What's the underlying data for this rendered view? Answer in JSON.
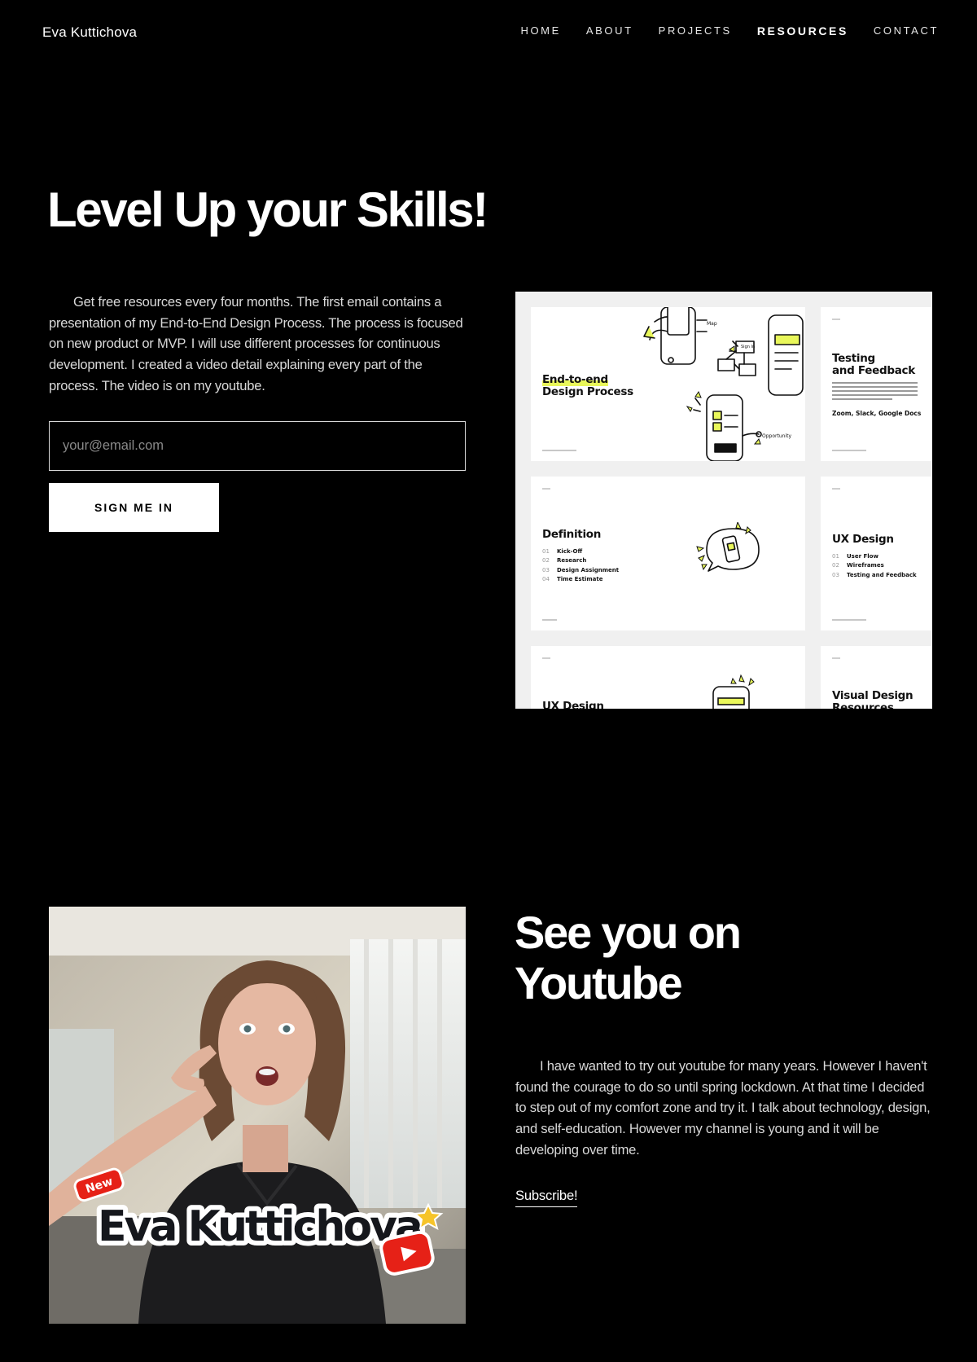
{
  "header": {
    "brand": "Eva Kuttichova",
    "nav": [
      {
        "label": "HOME"
      },
      {
        "label": "ABOUT"
      },
      {
        "label": "PROJECTS"
      },
      {
        "label": "RESOURCES",
        "active": true
      },
      {
        "label": "CONTACT"
      }
    ]
  },
  "hero": {
    "title": "Level Up your Skills!",
    "body": "Get free resources every four months. The first email contains a presentation of my End-to-End Design Process. The process is focused on new product or MVP. I will use different processes for continuous development. I created a video detail explaining every part of the process. The video is on my youtube.",
    "email_placeholder": "your@email.com",
    "email_value": "",
    "signup_label": "SIGN ME IN"
  },
  "slides": {
    "s1_title_a": "End-to-end",
    "s1_title_b": "Design Process",
    "s2_title_a": "Testing",
    "s2_title_b": "and Feedback",
    "s2_tools": "Zoom, Slack, Google Docs",
    "s3_title": "Definition",
    "s3_items": [
      {
        "n": "01",
        "label": "Kick-Off"
      },
      {
        "n": "02",
        "label": "Research"
      },
      {
        "n": "03",
        "label": "Design Assignment"
      },
      {
        "n": "04",
        "label": "Time Estimate"
      }
    ],
    "s4_title": "UX Design",
    "s4_items": [
      {
        "n": "01",
        "label": "User Flow"
      },
      {
        "n": "02",
        "label": "Wireframes"
      },
      {
        "n": "03",
        "label": "Testing and Feedback"
      }
    ],
    "s5_title": "UX Design",
    "s6_title_a": "Visual Design",
    "s6_title_b": "Resources",
    "sketch_labels": {
      "map": "Map",
      "sign_in": "Sign In",
      "opportunity": "Opportunity"
    }
  },
  "youtube": {
    "title_line1": "See you on",
    "title_line2": "Youtube",
    "body": "I have wanted to try out youtube for many years. However I haven't found the courage to do so until spring lockdown. At that time I decided to step out of my comfort zone and try it. I talk about technology, design, and self-education. However my channel is young and it will be developing over time.",
    "subscribe_label": "Subscribe!",
    "thumbnail": {
      "badge": "New",
      "name": "Eva Kuttichova"
    }
  },
  "colors": {
    "background": "#000000",
    "accent_yellow": "#e9f75a",
    "youtube_red": "#e62117"
  }
}
